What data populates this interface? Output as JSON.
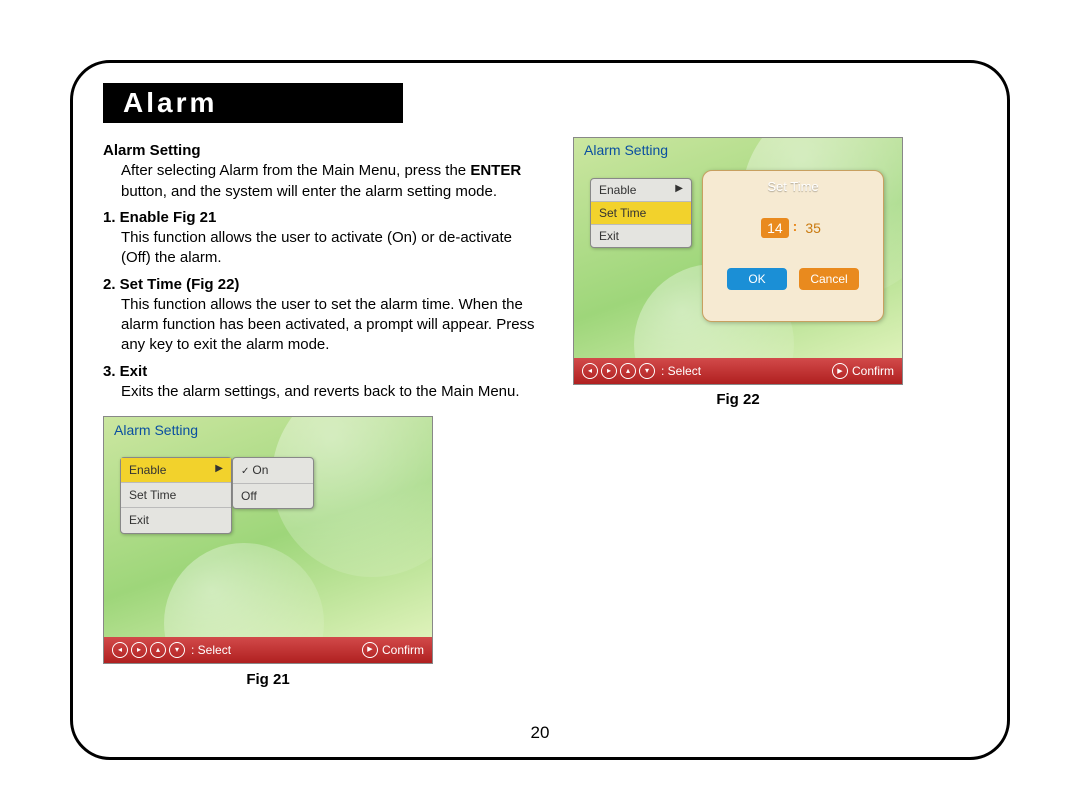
{
  "section_title": "Alarm",
  "page_number": "20",
  "text": {
    "alarm_setting_heading": "Alarm Setting",
    "alarm_setting_body_a": "After selecting Alarm from the Main Menu, press the",
    "alarm_setting_body_enter": "ENTER",
    "alarm_setting_body_b": " button, and the system will enter the alarm setting mode.",
    "enable_heading": "1. Enable Fig 21",
    "enable_body": "This function allows the user to activate (On) or de-activate (Off) the alarm.",
    "settime_heading": "2. Set Time (Fig 22)",
    "settime_body": "This function allows the user to set the alarm time. When the alarm function has been activated, a prompt will appear. Press any key to exit the alarm mode.",
    "exit_heading": "3. Exit",
    "exit_body": "Exits the alarm settings, and reverts back to the Main Menu."
  },
  "fig21": {
    "caption": "Fig 21",
    "screen_title": "Alarm Setting",
    "menu": {
      "enable": "Enable",
      "set_time": "Set Time",
      "exit": "Exit"
    },
    "submenu": {
      "on": "On",
      "off": "Off"
    },
    "footer_select": "Select",
    "footer_confirm": "Confirm"
  },
  "fig22": {
    "caption": "Fig 22",
    "screen_title": "Alarm Setting",
    "menu": {
      "enable": "Enable",
      "set_time": "Set Time",
      "exit": "Exit"
    },
    "panel_title": "Set Time",
    "time_hour": "14",
    "time_minute": "35",
    "ok": "OK",
    "cancel": "Cancel",
    "footer_select": "Select",
    "footer_confirm": "Confirm"
  }
}
